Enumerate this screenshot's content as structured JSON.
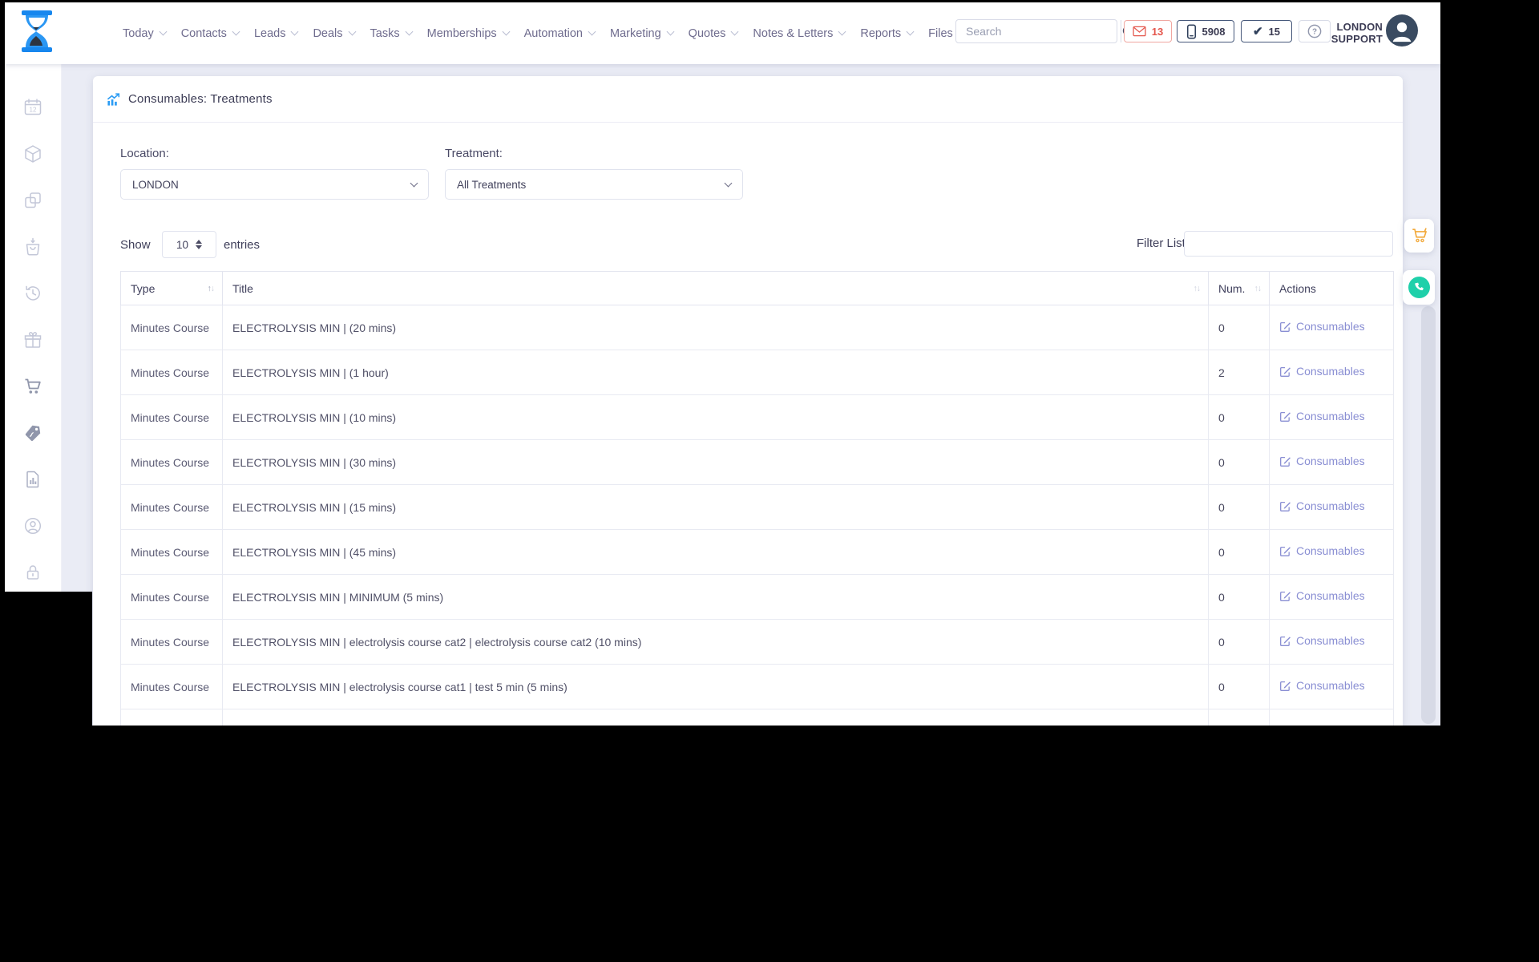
{
  "nav": {
    "items": [
      {
        "label": "Today",
        "chevron": true
      },
      {
        "label": "Contacts",
        "chevron": true
      },
      {
        "label": "Leads",
        "chevron": true
      },
      {
        "label": "Deals",
        "chevron": true
      },
      {
        "label": "Tasks",
        "chevron": true
      },
      {
        "label": "Memberships",
        "chevron": true
      },
      {
        "label": "Automation",
        "chevron": true
      },
      {
        "label": "Marketing",
        "chevron": true
      },
      {
        "label": "Quotes",
        "chevron": true
      },
      {
        "label": "Notes & Letters",
        "chevron": true
      },
      {
        "label": "Reports",
        "chevron": true
      },
      {
        "label": "Files",
        "chevron": false
      }
    ]
  },
  "topbar": {
    "search_placeholder": "Search",
    "mail_count": "13",
    "phone_count": "5908",
    "check_count": "15",
    "user_line1": "LONDON",
    "user_line2": "SUPPORT"
  },
  "sidebar": {
    "icons": [
      "calendar-icon",
      "cube-icon",
      "copy-icon",
      "shopping-bag-icon",
      "history-icon",
      "gift-icon",
      "cart-icon",
      "tag-icon",
      "report-icon",
      "user-circle-icon",
      "lock-icon"
    ]
  },
  "page": {
    "title": "Consumables: Treatments"
  },
  "filters": {
    "location_label": "Location:",
    "location_value": "LONDON",
    "treatment_label": "Treatment:",
    "treatment_value": "All Treatments"
  },
  "list_controls": {
    "show_label": "Show",
    "page_size": "10",
    "entries_label": "entries",
    "filter_label": "Filter List",
    "filter_value": ""
  },
  "table": {
    "headers": {
      "type": "Type",
      "title": "Title",
      "num": "Num.",
      "actions": "Actions"
    },
    "action_label": "Consumables",
    "rows": [
      {
        "type": "Minutes Course",
        "title": "ELECTROLYSIS MIN | (20 mins)",
        "num": "0"
      },
      {
        "type": "Minutes Course",
        "title": "ELECTROLYSIS MIN | (1 hour)",
        "num": "2"
      },
      {
        "type": "Minutes Course",
        "title": "ELECTROLYSIS MIN | (10 mins)",
        "num": "0"
      },
      {
        "type": "Minutes Course",
        "title": "ELECTROLYSIS MIN | (30 mins)",
        "num": "0"
      },
      {
        "type": "Minutes Course",
        "title": "ELECTROLYSIS MIN | (15 mins)",
        "num": "0"
      },
      {
        "type": "Minutes Course",
        "title": "ELECTROLYSIS MIN | (45 mins)",
        "num": "0"
      },
      {
        "type": "Minutes Course",
        "title": "ELECTROLYSIS MIN | MINIMUM (5 mins)",
        "num": "0"
      },
      {
        "type": "Minutes Course",
        "title": "ELECTROLYSIS MIN | electrolysis course cat2 | electrolysis course cat2 (10 mins)",
        "num": "0"
      },
      {
        "type": "Minutes Course",
        "title": "ELECTROLYSIS MIN | electrolysis course cat1 | test 5 min (5 mins)",
        "num": "0"
      }
    ]
  },
  "colors": {
    "accent_blue": "#2b9cf4",
    "alert_red": "#e4574d",
    "navy": "#3a4b61",
    "link_periwinkle": "#898ed3",
    "cart_orange": "#f2a93b",
    "whatsapp_teal": "#1fd0aa",
    "page_background": "#eaecf5"
  }
}
